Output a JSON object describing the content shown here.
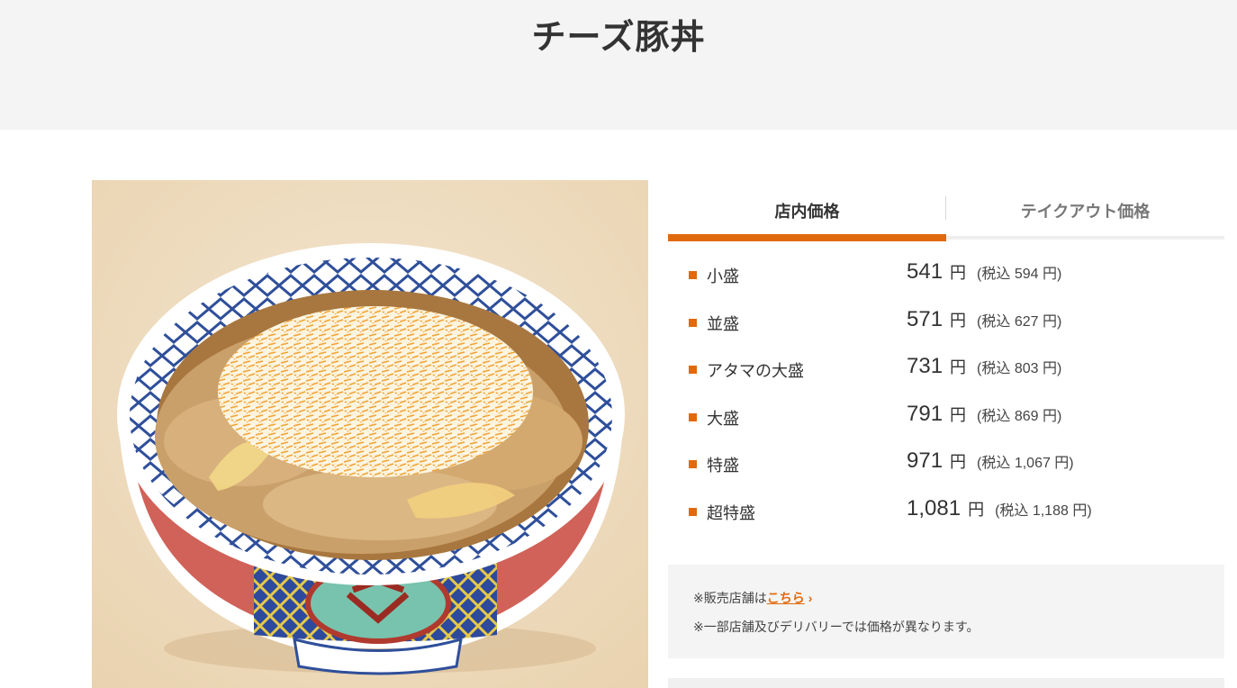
{
  "page": {
    "title": "チーズ豚丼"
  },
  "photo": {
    "alt_name": "cheese-butadon-bowl"
  },
  "tabs": [
    {
      "label": "店内価格",
      "active": true
    },
    {
      "label": "テイクアウト価格",
      "active": false
    }
  ],
  "prices": [
    {
      "size": "小盛",
      "price": "541",
      "yen": "円",
      "tax": "(税込 594 円)"
    },
    {
      "size": "並盛",
      "price": "571",
      "yen": "円",
      "tax": "(税込 627 円)"
    },
    {
      "size": "アタマの大盛",
      "price": "731",
      "yen": "円",
      "tax": "(税込 803 円)"
    },
    {
      "size": "大盛",
      "price": "791",
      "yen": "円",
      "tax": "(税込 869 円)"
    },
    {
      "size": "特盛",
      "price": "971",
      "yen": "円",
      "tax": "(税込 1,067 円)"
    },
    {
      "size": "超特盛",
      "price": "1,081",
      "yen": "円",
      "tax": "(税込 1,188 円)"
    }
  ],
  "notes": {
    "stores_prefix": "※販売店舗は",
    "stores_link": "こちら",
    "price_note": "※一部店舗及びデリバリーでは価格が異なります。"
  },
  "colors": {
    "accent": "#e06a0f",
    "header_bg": "#f4f4f4"
  }
}
